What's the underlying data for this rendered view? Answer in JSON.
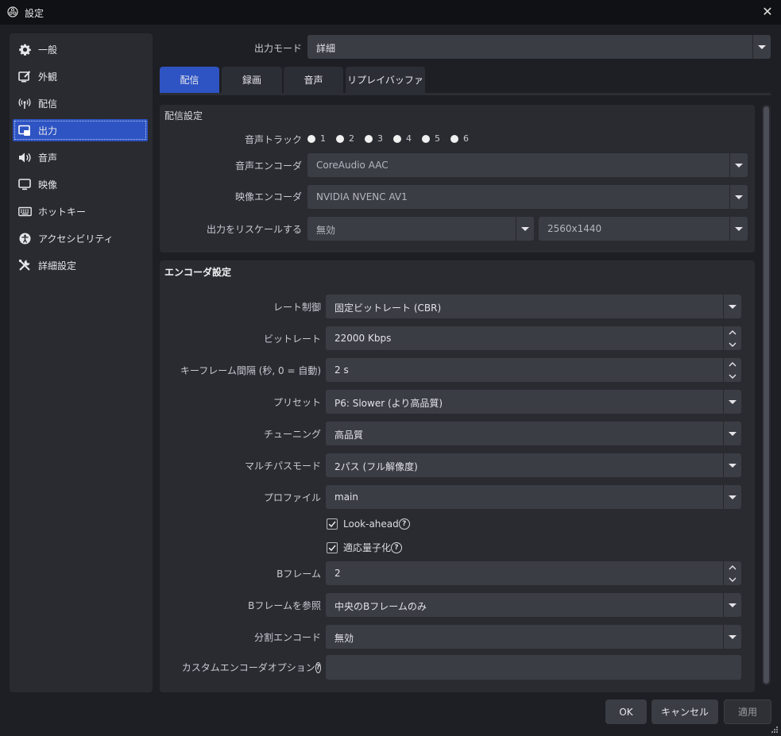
{
  "window": {
    "title": "設定"
  },
  "sidebar": {
    "items": [
      {
        "label": "一般",
        "icon": "gear-icon"
      },
      {
        "label": "外観",
        "icon": "appearance-icon"
      },
      {
        "label": "配信",
        "icon": "broadcast-icon"
      },
      {
        "label": "出力",
        "icon": "output-icon",
        "active": true
      },
      {
        "label": "音声",
        "icon": "speaker-icon"
      },
      {
        "label": "映像",
        "icon": "monitor-icon"
      },
      {
        "label": "ホットキー",
        "icon": "keyboard-icon"
      },
      {
        "label": "アクセシビリティ",
        "icon": "accessibility-icon"
      },
      {
        "label": "詳細設定",
        "icon": "tools-icon"
      }
    ]
  },
  "output_mode": {
    "label": "出力モード",
    "value": "詳細"
  },
  "tabs": [
    {
      "label": "配信",
      "active": true
    },
    {
      "label": "録画"
    },
    {
      "label": "音声"
    },
    {
      "label": "リプレイバッファ"
    }
  ],
  "stream_settings": {
    "heading": "配信設定",
    "audio_track_label": "音声トラック",
    "tracks": [
      "1",
      "2",
      "3",
      "4",
      "5",
      "6"
    ],
    "audio_encoder_label": "音声エンコーダ",
    "audio_encoder_value": "CoreAudio AAC",
    "video_encoder_label": "映像エンコーダ",
    "video_encoder_value": "NVIDIA NVENC AV1",
    "rescale_label": "出力をリスケールする",
    "rescale_value": "無効",
    "rescale_resolution": "2560x1440"
  },
  "encoder_settings": {
    "heading": "エンコーダ設定",
    "rate_control_label": "レート制御",
    "rate_control_value": "固定ビットレート (CBR)",
    "bitrate_label": "ビットレート",
    "bitrate_value": "22000 Kbps",
    "keyframe_label": "キーフレーム間隔 (秒, 0 = 自動)",
    "keyframe_value": "2 s",
    "preset_label": "プリセット",
    "preset_value": "P6: Slower (より高品質)",
    "tuning_label": "チューニング",
    "tuning_value": "高品質",
    "multipass_label": "マルチパスモード",
    "multipass_value": "2パス (フル解像度)",
    "profile_label": "プロファイル",
    "profile_value": "main",
    "lookahead_label": "Look-ahead",
    "adaptive_quant_label": "適応量子化",
    "bframes_label": "Bフレーム",
    "bframes_value": "2",
    "bframe_ref_label": "Bフレームを参照",
    "bframe_ref_value": "中央のBフレームのみ",
    "split_encode_label": "分割エンコード",
    "split_encode_value": "無効",
    "custom_options_label": "カスタムエンコーダオプション",
    "custom_options_value": ""
  },
  "footer": {
    "ok": "OK",
    "cancel": "キャンセル",
    "apply": "適用"
  },
  "colors": {
    "accent": "#2e54c3",
    "window_bg": "#1e1f24",
    "panel_bg": "#2a2b31",
    "field_bg": "#3b3d45"
  }
}
